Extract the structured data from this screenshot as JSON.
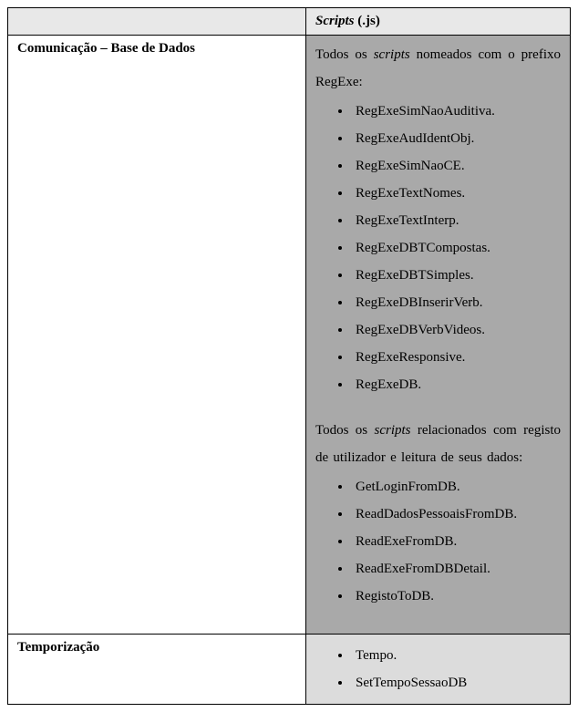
{
  "header": {
    "left": "",
    "right_italic": "Scripts",
    "right_ext": " (.js)"
  },
  "row1": {
    "left": "Comunicação – Base de Dados",
    "intro1_prefix": "Todos os ",
    "intro1_italic": "scripts",
    "intro1_suffix": " nomeados com o prefixo RegExe:",
    "list1": [
      "RegExeSimNaoAuditiva.",
      "RegExeAudIdentObj.",
      "RegExeSimNaoCE.",
      "RegExeTextNomes.",
      "RegExeTextInterp.",
      "RegExeDBTCompostas.",
      "RegExeDBTSimples.",
      "RegExeDBInserirVerb.",
      "RegExeDBVerbVideos.",
      "RegExeResponsive.",
      "RegExeDB."
    ],
    "intro2_prefix": "Todos os ",
    "intro2_italic": "scripts",
    "intro2_suffix": " relacionados com registo de utilizador e leitura de seus dados:",
    "list2": [
      "GetLoginFromDB.",
      "ReadDadosPessoaisFromDB.",
      "ReadExeFromDB.",
      "ReadExeFromDBDetail.",
      "RegistoToDB."
    ]
  },
  "row2": {
    "left": "Temporização",
    "list": [
      "Tempo.",
      "SetTempoSessaoDB"
    ]
  }
}
